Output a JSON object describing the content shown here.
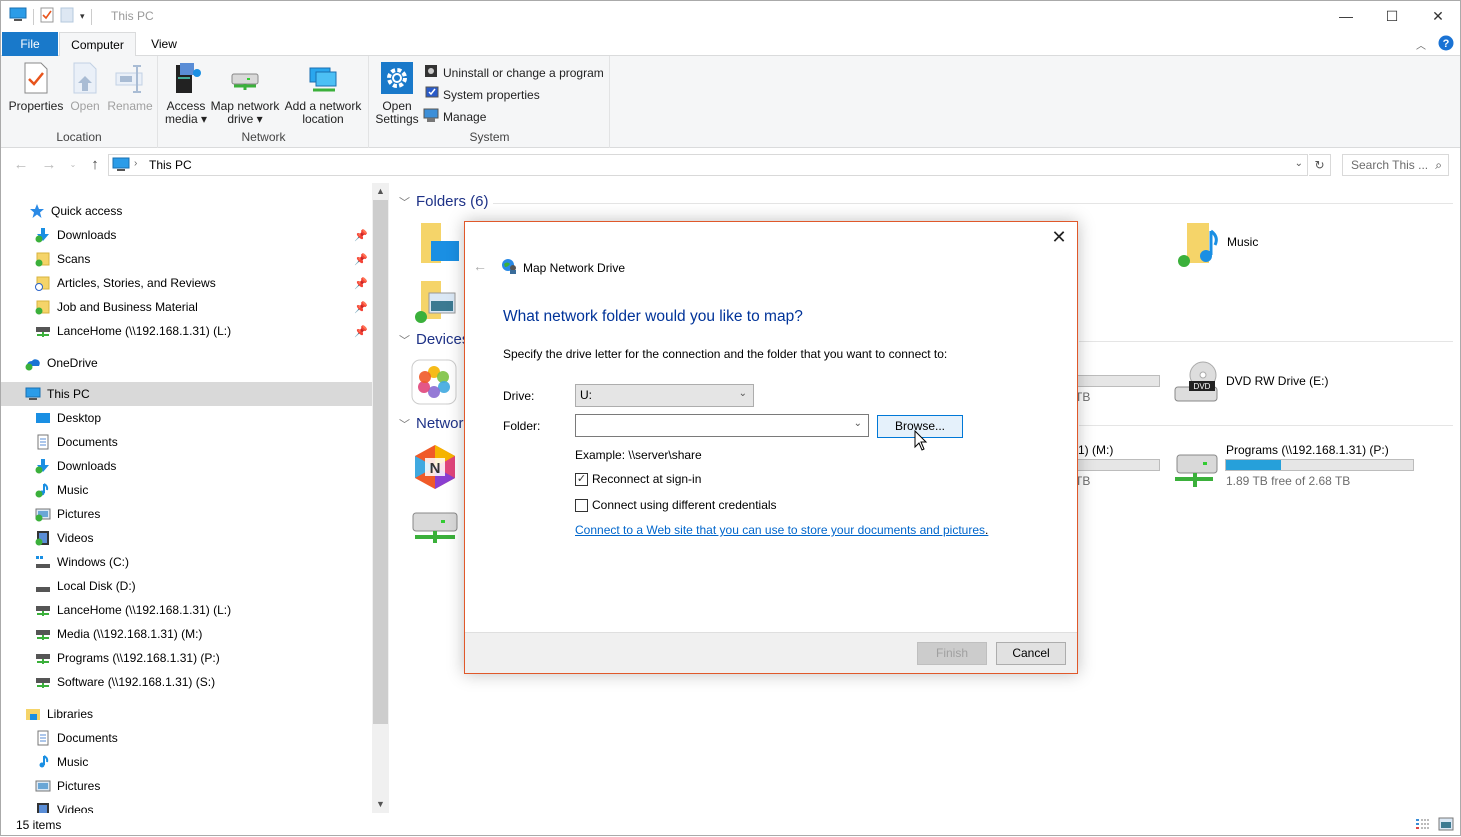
{
  "window": {
    "title": "This PC",
    "controls": {
      "minimize": "—",
      "maximize": "☐",
      "close": "✕"
    }
  },
  "ribbon": {
    "tabs": [
      {
        "label": "File"
      },
      {
        "label": "Computer",
        "active": true
      },
      {
        "label": "View"
      }
    ],
    "groups": [
      {
        "label": "Location",
        "buttons": [
          {
            "label": "Properties",
            "icon": "properties-icon"
          },
          {
            "label": "Open",
            "icon": "open-icon",
            "disabled": true
          },
          {
            "label": "Rename",
            "icon": "rename-icon",
            "disabled": true
          }
        ]
      },
      {
        "label": "Network",
        "buttons": [
          {
            "label": "Access media",
            "line1": "Access",
            "line2": "media ▾",
            "icon": "access-media-icon"
          },
          {
            "label": "Map network drive",
            "line1": "Map network",
            "line2": "drive ▾",
            "icon": "map-drive-icon"
          },
          {
            "label": "Add a network location",
            "line1": "Add a network",
            "line2": "location",
            "icon": "network-location-icon"
          }
        ]
      },
      {
        "label": "System",
        "buttons": [
          {
            "label": "Open Settings",
            "line1": "Open",
            "line2": "Settings",
            "icon": "settings-gear-icon"
          }
        ],
        "small_buttons": [
          {
            "label": "Uninstall or change a program",
            "icon": "uninstall-icon"
          },
          {
            "label": "System properties",
            "icon": "system-properties-icon"
          },
          {
            "label": "Manage",
            "icon": "manage-icon"
          }
        ]
      }
    ]
  },
  "address_bar": {
    "path": "This PC",
    "search_placeholder": "Search This ..."
  },
  "nav_pane": {
    "quick_access": {
      "label": "Quick access",
      "items": [
        {
          "label": "Downloads",
          "pinned": true
        },
        {
          "label": "Scans",
          "pinned": true
        },
        {
          "label": "Articles, Stories, and Reviews",
          "pinned": true
        },
        {
          "label": "Job and Business Material",
          "pinned": true
        },
        {
          "label": "LanceHome (\\\\192.168.1.31) (L:)",
          "pinned": true
        }
      ]
    },
    "onedrive": {
      "label": "OneDrive"
    },
    "this_pc": {
      "label": "This PC",
      "selected": true,
      "items": [
        {
          "label": "Desktop"
        },
        {
          "label": "Documents"
        },
        {
          "label": "Downloads"
        },
        {
          "label": "Music"
        },
        {
          "label": "Pictures"
        },
        {
          "label": "Videos"
        },
        {
          "label": "Windows (C:)"
        },
        {
          "label": "Local Disk (D:)"
        },
        {
          "label": "LanceHome (\\\\192.168.1.31) (L:)"
        },
        {
          "label": "Media (\\\\192.168.1.31) (M:)"
        },
        {
          "label": "Programs (\\\\192.168.1.31) (P:)"
        },
        {
          "label": "Software (\\\\192.168.1.31) (S:)"
        }
      ]
    },
    "libraries": {
      "label": "Libraries",
      "items": [
        {
          "label": "Documents"
        },
        {
          "label": "Music"
        },
        {
          "label": "Pictures"
        },
        {
          "label": "Videos"
        }
      ]
    }
  },
  "content": {
    "groups": [
      {
        "label": "Folders (6)"
      },
      {
        "label": "Devices"
      },
      {
        "label": "Networ"
      }
    ],
    "visible_tiles": [
      {
        "name": "Music",
        "type": "folder"
      },
      {
        "name": "DVD RW Drive (E:)",
        "type": "dvd"
      },
      {
        "name": "Programs (\\\\192.168.1.31) (P:)",
        "type": "network-drive",
        "free_text": "1.89 TB free of 2.68 TB",
        "used_fraction": 0.295
      },
      {
        "name_partial": "1) (M:)",
        "free_text_partial": "TB"
      },
      {
        "free_text_partial": "TB"
      }
    ]
  },
  "status_bar": {
    "items_count": "15 items"
  },
  "dialog": {
    "title": "Map Network Drive",
    "heading": "What network folder would you like to map?",
    "description": "Specify the drive letter for the connection and the folder that you want to connect to:",
    "drive_label": "Drive:",
    "drive_value": "U:",
    "folder_label": "Folder:",
    "folder_value": "",
    "browse_label": "Browse...",
    "example": "Example: \\\\server\\share",
    "reconnect_label": "Reconnect at sign-in",
    "reconnect_checked": true,
    "credentials_label": "Connect using different credentials",
    "credentials_checked": false,
    "link_text": "Connect to a Web site that you can use to store your documents and pictures",
    "finish_label": "Finish",
    "cancel_label": "Cancel"
  }
}
